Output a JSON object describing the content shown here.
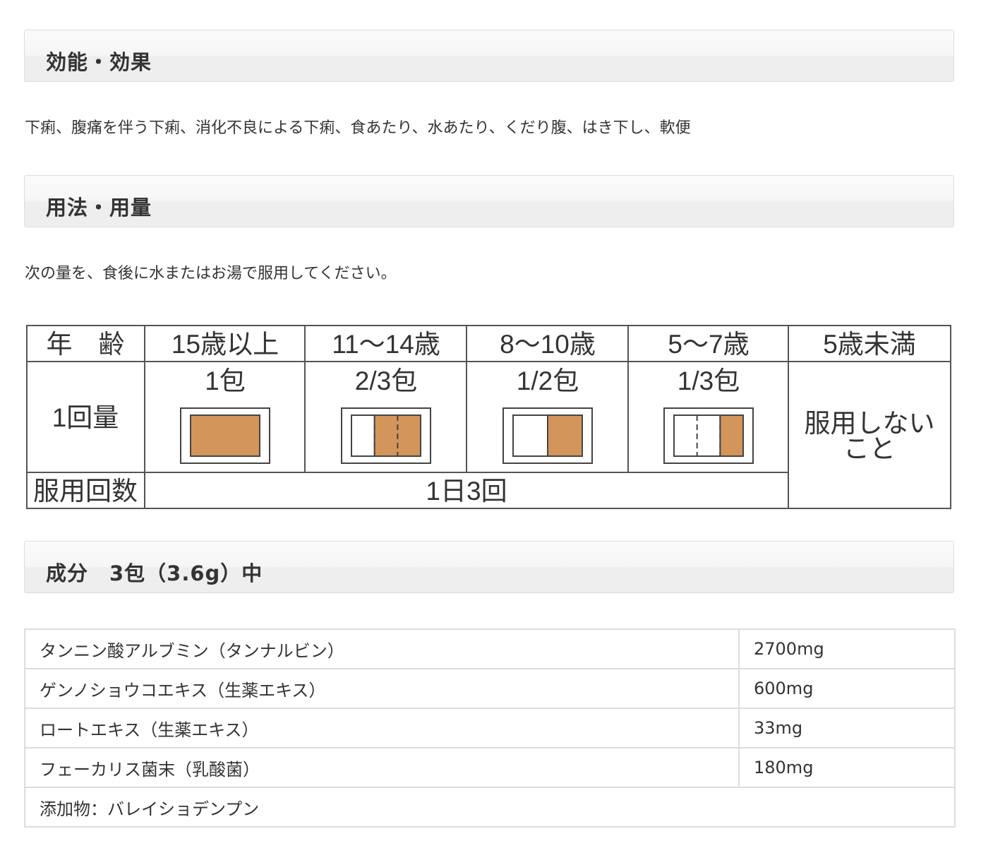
{
  "sections": {
    "efficacy": {
      "title": "効能・効果",
      "text": "下痢、腹痛を伴う下痢、消化不良による下痢、食あたり、水あたり、くだり腹、はき下し、軟便"
    },
    "dosage": {
      "title": "用法・用量",
      "text": "次の量を、食後に水またはお湯で服用してください。"
    },
    "ingredients": {
      "title": "成分　3包（3.6g）中"
    }
  },
  "dosage_table": {
    "header_label": "年　齢",
    "dose_label": "1回量",
    "freq_label": "服用回数",
    "freq_value": "1日3回",
    "columns": [
      {
        "age": "15歳以上",
        "dose": "1包",
        "fill": 1.0
      },
      {
        "age": "11～14歳",
        "dose": "2/3包",
        "fill": 0.667
      },
      {
        "age": "8～10歳",
        "dose": "1/2包",
        "fill": 0.5
      },
      {
        "age": "5～7歳",
        "dose": "1/3包",
        "fill": 0.333
      }
    ],
    "under5_age": "5歳未満",
    "under5_line1": "服用しない",
    "under5_line2": "こと",
    "packet_color": "#d3955a"
  },
  "ingredients": [
    {
      "name": "タンニン酸アルブミン（タンナルビン）",
      "amount": "2700mg"
    },
    {
      "name": "ゲンノショウコエキス（生薬エキス）",
      "amount": "600mg"
    },
    {
      "name": "ロートエキス（生薬エキス）",
      "amount": "33mg"
    },
    {
      "name": "フェーカリス菌末（乳酸菌）",
      "amount": "180mg"
    }
  ],
  "additives": "添加物：バレイショデンプン"
}
